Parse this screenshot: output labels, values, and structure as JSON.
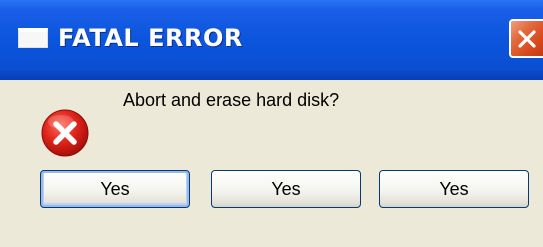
{
  "window": {
    "title": "FATAL ERROR",
    "title_icon": "window-icon",
    "close_icon": "close-x-icon"
  },
  "dialog": {
    "icon": "error-circle-x-icon",
    "message": "Abort and erase hard disk?",
    "buttons": [
      {
        "label": "Yes",
        "default": true
      },
      {
        "label": "Yes",
        "default": false
      },
      {
        "label": "Yes",
        "default": false
      }
    ]
  },
  "colors": {
    "titlebar": "#0a53d8",
    "close_button": "#d9491e",
    "client_background": "#ece9d8",
    "error_icon": "#d11a1a"
  }
}
